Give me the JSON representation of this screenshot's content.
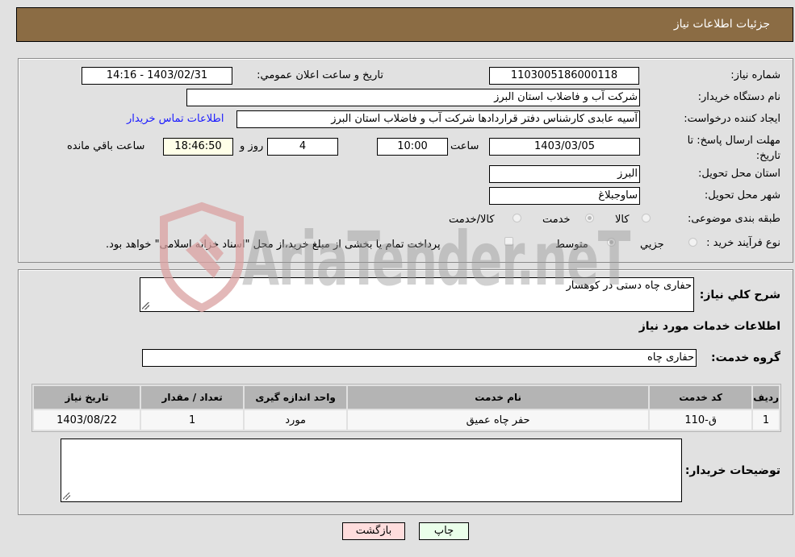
{
  "header": {
    "title": "جزئیات اطلاعات نیاز"
  },
  "details": {
    "need_number_label": "شماره نیاز:",
    "need_number": "1103005186000118",
    "announce_label": "تاريخ و ساعت اعلان عمومي:",
    "announce_value": "1403/02/31 - 14:16",
    "buyer_org_label": "نام دستگاه خريدار:",
    "buyer_org": "شرکت آب و فاضلاب استان البرز",
    "creator_label": "ايجاد کننده درخواست:",
    "creator": "آسیه عابدی کارشناس دفتر قراردادها شرکت آب و فاضلاب استان البرز",
    "contact_link": "اطلاعات تماس خريدار",
    "deadline_label": "مهلت ارسال پاسخ: تا تاريخ:",
    "deadline_date": "1403/03/05",
    "time_label": "ساعت",
    "deadline_time": "10:00",
    "days_value": "4",
    "days_label": "روز و",
    "remaining_time": "18:46:50",
    "remaining_label": "ساعت باقي مانده",
    "province_label": "استان محل تحويل:",
    "province": "البرز",
    "city_label": "شهر محل تحويل:",
    "city": "ساوجبلاغ",
    "category_label": "طبقه بندی موضوعی:",
    "category_options": [
      {
        "label": "کالا",
        "selected": false
      },
      {
        "label": "خدمت",
        "selected": true
      },
      {
        "label": "کالا/خدمت",
        "selected": false
      }
    ],
    "process_label": "نوع فرآيند خريد :",
    "process_options": [
      {
        "label": "جزيي",
        "selected": false
      },
      {
        "label": "متوسط",
        "selected": true
      }
    ],
    "treasury_note": "پرداخت تمام یا بخشی از مبلغ خرید،از محل \"اسناد خزانه اسلامی\" خواهد بود."
  },
  "services": {
    "description_label": "شرح کلي نياز:",
    "description": "حفاری چاه دستی در کوهسار",
    "section_title": "اطلاعات خدمات مورد نياز",
    "group_label": "گروه خدمت:",
    "group_value": "حفاری چاه",
    "table": {
      "headers": [
        "رديف",
        "کد خدمت",
        "نام خدمت",
        "واحد اندازه گيری",
        "تعداد / مقدار",
        "تاريخ نياز"
      ],
      "rows": [
        [
          "1",
          "ق-110",
          "حفر چاه عمیق",
          "مورد",
          "1",
          "1403/08/22"
        ]
      ]
    },
    "buyer_notes_label": "توضيحات خريدار:",
    "buyer_notes": ""
  },
  "buttons": {
    "print": "چاپ",
    "back": "بازگشت"
  },
  "watermark": {
    "text": "AriaTender.neT"
  },
  "colors": {
    "header_bg": "#8b6c44",
    "print_bg": "#eaffea",
    "back_bg": "#ffdddd",
    "link": "#1a1aff"
  }
}
